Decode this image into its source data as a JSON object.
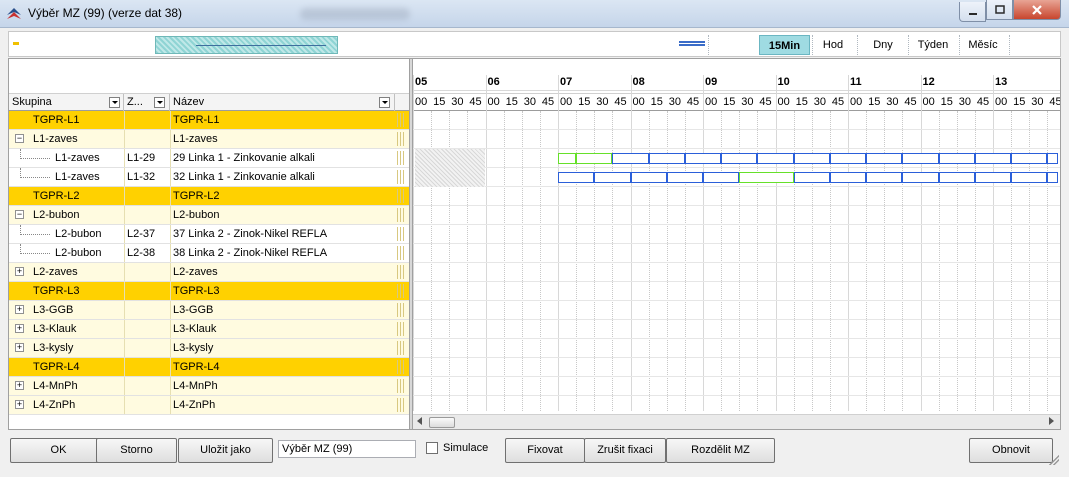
{
  "window": {
    "title": "Výběr MZ (99) (verze dat 38)"
  },
  "toolbar": {
    "scales": [
      {
        "label": "15Min",
        "active": true
      },
      {
        "label": "Hod",
        "active": false
      },
      {
        "label": "Dny",
        "active": false
      },
      {
        "label": "Týden",
        "active": false
      },
      {
        "label": "Měsíc",
        "active": false
      }
    ]
  },
  "grid": {
    "columns": {
      "skupina": "Skupina",
      "z": "Z...",
      "nazev": "Název"
    },
    "rows": [
      {
        "skupina": "TGPR-L1",
        "z": "",
        "nazev": "TGPR-L1",
        "level": 0,
        "type": "group",
        "expander": ""
      },
      {
        "skupina": "L1-zaves",
        "z": "",
        "nazev": "L1-zaves",
        "level": 0,
        "type": "node",
        "expander": "−"
      },
      {
        "skupina": "L1-zaves",
        "z": "L1-29",
        "nazev": "29 Linka 1 - Zinkovanie alkali",
        "level": 1,
        "type": "leaf",
        "expander": ""
      },
      {
        "skupina": "L1-zaves",
        "z": "L1-32",
        "nazev": "32 Linka 1 - Zinkovanie alkali",
        "level": 1,
        "type": "leaf",
        "expander": ""
      },
      {
        "skupina": "TGPR-L2",
        "z": "",
        "nazev": "TGPR-L2",
        "level": 0,
        "type": "group",
        "expander": ""
      },
      {
        "skupina": "L2-bubon",
        "z": "",
        "nazev": "L2-bubon",
        "level": 0,
        "type": "node",
        "expander": "−"
      },
      {
        "skupina": "L2-bubon",
        "z": "L2-37",
        "nazev": "37 Linka 2 - Zinok-Nikel REFLA",
        "level": 1,
        "type": "leaf",
        "expander": ""
      },
      {
        "skupina": "L2-bubon",
        "z": "L2-38",
        "nazev": "38 Linka 2 - Zinok-Nikel REFLA",
        "level": 1,
        "type": "leaf",
        "expander": ""
      },
      {
        "skupina": "L2-zaves",
        "z": "",
        "nazev": "L2-zaves",
        "level": 0,
        "type": "node",
        "expander": "+"
      },
      {
        "skupina": "TGPR-L3",
        "z": "",
        "nazev": "TGPR-L3",
        "level": 0,
        "type": "group",
        "expander": ""
      },
      {
        "skupina": "L3-GGB",
        "z": "",
        "nazev": "L3-GGB",
        "level": 0,
        "type": "node",
        "expander": "+"
      },
      {
        "skupina": "L3-Klauk",
        "z": "",
        "nazev": "L3-Klauk",
        "level": 0,
        "type": "node",
        "expander": "+"
      },
      {
        "skupina": "L3-kysly",
        "z": "",
        "nazev": "L3-kysly",
        "level": 0,
        "type": "node",
        "expander": "+"
      },
      {
        "skupina": "TGPR-L4",
        "z": "",
        "nazev": "TGPR-L4",
        "level": 0,
        "type": "group",
        "expander": ""
      },
      {
        "skupina": "L4-MnPh",
        "z": "",
        "nazev": "L4-MnPh",
        "level": 0,
        "type": "node",
        "expander": "+"
      },
      {
        "skupina": "L4-ZnPh",
        "z": "",
        "nazev": "L4-ZnPh",
        "level": 0,
        "type": "node",
        "expander": "+"
      }
    ]
  },
  "timeline": {
    "hours": [
      "05",
      "06",
      "07",
      "08",
      "09",
      "10",
      "11",
      "12",
      "13"
    ],
    "minutes": [
      "00",
      "15",
      "30",
      "45"
    ],
    "schedule": [
      {
        "row": 2,
        "slots": [
          {
            "hour": "07",
            "start_min": 0,
            "end_min": 15,
            "color": "green"
          },
          {
            "hour": "07",
            "start_min": 15,
            "end_min": 45,
            "color": "green"
          },
          {
            "hour": "07",
            "start_min": 45,
            "end_min": 900,
            "color": "blue"
          }
        ]
      },
      {
        "row": 3,
        "slots": [
          {
            "hour": "07",
            "start_min": 0,
            "end_min": 150,
            "color": "blue"
          },
          {
            "hour": "07",
            "start_min": 150,
            "end_min": 195,
            "color": "green"
          },
          {
            "hour": "07",
            "start_min": 195,
            "end_min": 900,
            "color": "blue"
          }
        ]
      }
    ],
    "colors": {
      "blue": "#2b5fd9",
      "green": "#66e02a",
      "group": "#ffd100",
      "scale_active": "#9fdbe2"
    }
  },
  "footer": {
    "ok": "OK",
    "storno": "Storno",
    "ulozit_jako": "Uložit jako",
    "name_value": "Výběr MZ (99)",
    "simulace": "Simulace",
    "fixovat": "Fixovat",
    "zrusit_fixaci": "Zrušit fixaci",
    "rozdelit_mz": "Rozdělit MZ",
    "obnovit": "Obnovit"
  }
}
